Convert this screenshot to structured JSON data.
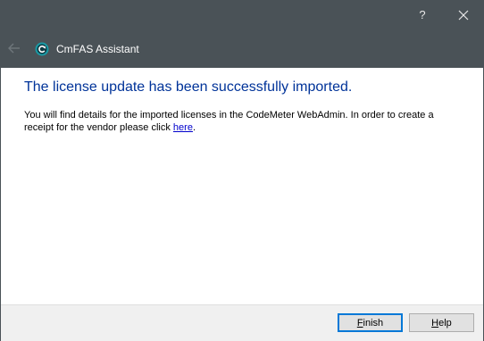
{
  "titlebar": {
    "help_glyph": "?",
    "app_title": "CmFAS Assistant",
    "icons": {
      "back": "back-arrow-icon",
      "app": "cmfas-logo-icon",
      "close": "close-icon"
    }
  },
  "content": {
    "heading": "The license update has been successfully imported.",
    "paragraph_before_link": "You will find details for the imported licenses in the CodeMeter WebAdmin. In order to create a receipt for the vendor please click ",
    "link_text": "here",
    "paragraph_after_link": "."
  },
  "footer": {
    "finish_mnemonic": "F",
    "finish_rest": "inish",
    "help_mnemonic": "H",
    "help_rest": "elp"
  },
  "colors": {
    "titlebar": "#4a5257",
    "heading": "#003399",
    "link": "#0000cc",
    "footer": "#f0f0f0",
    "default_button_border": "#0078d7"
  }
}
